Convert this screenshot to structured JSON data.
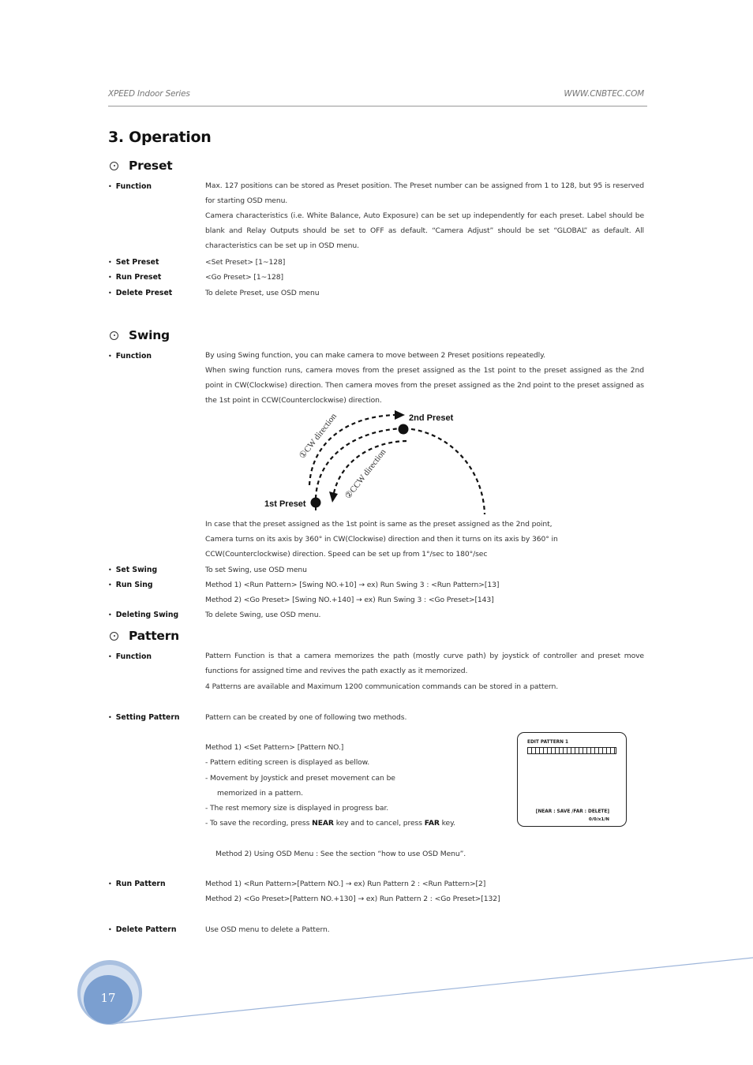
{
  "header": {
    "series": "XPEED Indoor Series",
    "website": "WWW.CNBTEC.COM"
  },
  "chapter_title": "3. Operation",
  "sections": {
    "preset": {
      "title": "Preset",
      "icon": "circle-dot-icon",
      "function_label": "Function",
      "function_text_1": "Max. 127 positions can be stored as Preset position. The Preset number can be assigned from 1 to 128, but 95 is reserved for starting OSD menu.",
      "function_text_2": "Camera characteristics (i.e. White Balance, Auto Exposure) can be set up independently for each preset. Label should be blank and Relay Outputs should be set to OFF as default. “Camera Adjust” should be set “GLOBAL” as default. All characteristics can be set up in OSD menu.",
      "set_label": "Set Preset",
      "set_text": "<Set Preset> [1~128]",
      "run_label": "Run Preset",
      "run_text": "<Go Preset> [1~128]",
      "delete_label": "Delete Preset",
      "delete_text": "To delete Preset, use OSD menu"
    },
    "swing": {
      "title": "Swing",
      "icon": "circle-dot-icon",
      "function_label": "Function",
      "function_text_1": "By using Swing function, you can make camera to move between 2 Preset positions repeatedly.",
      "function_text_2": "When swing function runs, camera moves from the preset assigned as the 1st point to the preset assigned as the 2nd point in CW(Clockwise) direction. Then camera moves from the preset assigned as the 2nd point to the preset assigned as the 1st point in CCW(Counterclockwise) direction.",
      "diagram": {
        "first_preset": "1st Preset",
        "second_preset": "2nd Preset",
        "cw_label": "①CW direction",
        "ccw_label": "②CCW direction"
      },
      "same_point_1": "In case that the preset assigned as the 1st point is same as the preset assigned as the 2nd point,",
      "same_point_2": "Camera turns on its axis by 360° in CW(Clockwise) direction and then it turns on its axis by 360° in",
      "same_point_3": "CCW(Counterclockwise) direction. Speed can be set up from 1°/sec to 180°/sec",
      "set_label": "Set Swing",
      "set_text": "To set Swing, use OSD menu",
      "run_label": "Run Sing",
      "run_method_1": "Method 1)   <Run Pattern> [Swing NO.+10]  →  ex) Run Swing 3 : <Run Pattern>[13]",
      "run_method_2": "Method 2)   <Go Preset> [Swing NO.+140]  →  ex) Run Swing 3 : <Go Preset>[143]",
      "delete_label": "Deleting Swing",
      "delete_text": "To delete Swing, use OSD menu."
    },
    "pattern": {
      "title": "Pattern",
      "icon": "circle-dot-icon",
      "function_label": "Function",
      "function_text_1": "Pattern Function is that a camera memorizes the path (mostly curve path) by joystick of controller and preset move functions for assigned time and revives the path exactly as it memorized.",
      "function_text_2": "4 Patterns are available and Maximum 1200 communication commands can be stored in a pattern.",
      "setting_label": "Setting Pattern",
      "setting_text": "Pattern can be created by one of following two methods.",
      "method1_title": "Method 1) <Set Pattern> [Pattern NO.]",
      "method1_step1": "- Pattern editing screen is displayed as bellow.",
      "method1_step2a": "- Movement by Joystick and preset movement can be",
      "method1_step2b": "memorized in a pattern.",
      "method1_step3": "- The rest memory size is displayed in progress bar.",
      "method1_step4_pre": "- To save the recording, press ",
      "method1_step4_near": "NEAR",
      "method1_step4_mid": " key and to cancel, press ",
      "method1_step4_far": "FAR",
      "method1_step4_post": " key.",
      "method2": "Method 2) Using OSD Menu : See the section “how to use OSD Menu”.",
      "osd": {
        "title": "EDIT PATTERN 1",
        "hint": "[NEAR : SAVE /FAR : DELETE]",
        "count": "0/0/x1/N",
        "memory_used_fraction": 0
      },
      "run_label": "Run Pattern",
      "run_method_1": "Method 1) <Run Pattern>[Pattern NO.]          →  ex) Run Pattern 2 : <Run Pattern>[2]",
      "run_method_2": "Method 2) <Go Preset>[Pattern NO.+130]  →  ex) Run Pattern 2 : <Go Preset>[132]",
      "delete_label": "Delete Pattern",
      "delete_text": "Use OSD menu to delete a Pattern."
    }
  },
  "footer": {
    "page_number": "17",
    "accent_color": "#7a9fcf"
  }
}
